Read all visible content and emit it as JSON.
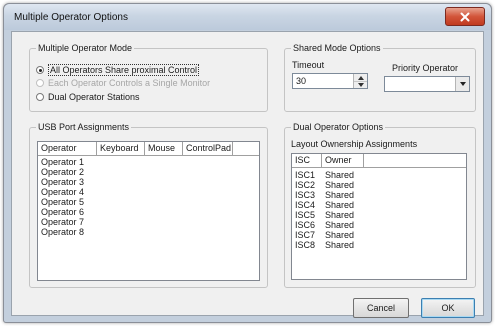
{
  "window": {
    "title": "Multiple Operator Options"
  },
  "mode_group": {
    "label": "Multiple Operator Mode",
    "options": [
      {
        "label": "All Operators Share proximal Control",
        "checked": true,
        "enabled": true
      },
      {
        "label": "Each Operator Controls a Single Monitor",
        "checked": false,
        "enabled": false
      },
      {
        "label": "Dual Operator Stations",
        "checked": false,
        "enabled": true
      }
    ]
  },
  "shared_group": {
    "label": "Shared Mode Options",
    "timeout_label": "Timeout",
    "timeout_value": "30",
    "priority_label": "Priority Operator",
    "priority_value": ""
  },
  "usb_group": {
    "label": "USB Port Assignments",
    "columns": [
      "Operator",
      "Keyboard",
      "Mouse",
      "ControlPad"
    ],
    "rows": [
      "Operator 1",
      "Operator 2",
      "Operator 3",
      "Operator 4",
      "Operator 5",
      "Operator 6",
      "Operator 7",
      "Operator 8"
    ]
  },
  "dual_group": {
    "label": "Dual Operator Options",
    "sublabel": "Layout Ownership Assignments",
    "columns": [
      "ISC",
      "Owner"
    ],
    "rows": [
      {
        "isc": "ISC1",
        "owner": "Shared"
      },
      {
        "isc": "ISC2",
        "owner": "Shared"
      },
      {
        "isc": "ISC3",
        "owner": "Shared"
      },
      {
        "isc": "ISC4",
        "owner": "Shared"
      },
      {
        "isc": "ISC5",
        "owner": "Shared"
      },
      {
        "isc": "ISC6",
        "owner": "Shared"
      },
      {
        "isc": "ISC7",
        "owner": "Shared"
      },
      {
        "isc": "ISC8",
        "owner": "Shared"
      }
    ]
  },
  "buttons": {
    "cancel": "Cancel",
    "ok": "OK"
  }
}
